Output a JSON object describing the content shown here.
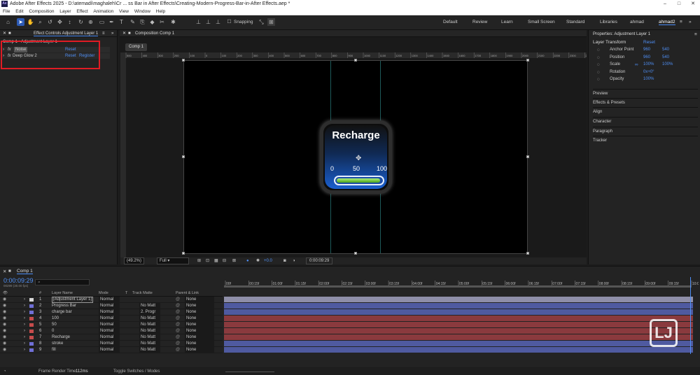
{
  "window": {
    "title": "Adobe After Effects 2025 - D:\\atemadi\\maghaleh\\Cr ... ss Bar in After Effects\\Creating-Modern-Progress-Bar-in-After Effects.aep *",
    "logo": "Ae"
  },
  "menu": [
    "File",
    "Edit",
    "Composition",
    "Layer",
    "Effect",
    "Animation",
    "View",
    "Window",
    "Help"
  ],
  "toolbar": {
    "snapping_label": "Snapping",
    "workspaces": [
      "Default",
      "Review",
      "Learn",
      "Small Screen",
      "Standard",
      "Libraries",
      "ahmad",
      "ahmad2"
    ],
    "active_workspace": "ahmad2"
  },
  "effect_controls": {
    "tab": "Effect Controls Adjustment Layer 1",
    "breadcrumb": "Comp 1 • Adjustment Layer 1",
    "effects": [
      {
        "name": "Noise",
        "reset": "Reset",
        "register": ""
      },
      {
        "name": "Deep Glow 2",
        "reset": "Reset",
        "register": "Register"
      }
    ]
  },
  "composition": {
    "tab": "Composition Comp 1",
    "comp_tab": "Comp 1",
    "zoom": "(49.2%)",
    "resolution": "Full",
    "exposure": "+0.0",
    "timecode": "0:00:09:29",
    "ruler": [
      "500",
      "400",
      "300",
      "200",
      "100",
      "0",
      "100",
      "200",
      "300",
      "400",
      "500",
      "600",
      "700",
      "800",
      "900",
      "1000",
      "1100",
      "1200",
      "1300",
      "1400",
      "1500",
      "1600",
      "1700",
      "1800",
      "1900",
      "2000",
      "2100",
      "2200",
      "2300",
      "2400"
    ]
  },
  "widget": {
    "title": "Recharge",
    "scale": [
      "0",
      "50",
      "100"
    ],
    "progress": 0.97
  },
  "properties": {
    "header": "Properties: Adjustment Layer 1",
    "section": "Layer Transform",
    "reset": "Reset",
    "rows": [
      {
        "label": "Anchor Point",
        "v1": "960",
        "v2": "540"
      },
      {
        "label": "Position",
        "v1": "960",
        "v2": "540"
      },
      {
        "label": "Scale",
        "v1": "100%",
        "v2": "100%"
      },
      {
        "label": "Rotation",
        "v1": "0x+0°",
        "v2": ""
      },
      {
        "label": "Opacity",
        "v1": "100%",
        "v2": ""
      }
    ],
    "panels": [
      "Preview",
      "Effects & Presets",
      "Align",
      "Character",
      "Paragraph",
      "Tracker"
    ]
  },
  "timeline": {
    "tab": "Comp 1",
    "timecode": "0:00:09:29",
    "fps": "00299 (30.00 fps)",
    "headers": {
      "num": "#",
      "layer": "Layer Name",
      "mode": "Mode",
      "t": "T",
      "matte": "Track Matte",
      "parent": "Parent & Link"
    },
    "ticks": [
      "00f",
      "00:15f",
      "01:00f",
      "01:15f",
      "02:00f",
      "02:15f",
      "03:00f",
      "03:15f",
      "04:00f",
      "04:15f",
      "05:00f",
      "05:15f",
      "06:00f",
      "06:15f",
      "07:00f",
      "07:15f",
      "08:00f",
      "08:15f",
      "09:00f",
      "09:15f",
      "10:0"
    ],
    "layers": [
      {
        "n": "1",
        "name": "[Adjustment Layer 1]",
        "mode": "Normal",
        "matte": "",
        "parent": "None",
        "color": "#d8d8d8",
        "bar": "#8e8ea8"
      },
      {
        "n": "2",
        "name": "Progress Bar",
        "mode": "Normal",
        "matte": "No Matt",
        "parent": "None",
        "color": "#6f6fd6",
        "bar": "#4f5aa0"
      },
      {
        "n": "3",
        "name": "charge bar",
        "mode": "Normal",
        "matte": "2. Progr",
        "parent": "None",
        "color": "#6f6fd6",
        "bar": "#4f5aa0"
      },
      {
        "n": "4",
        "name": "100",
        "mode": "Normal",
        "matte": "No Matt",
        "parent": "None",
        "color": "#c64c4c",
        "bar": "#8a3a3e"
      },
      {
        "n": "5",
        "name": "50",
        "mode": "Normal",
        "matte": "No Matt",
        "parent": "None",
        "color": "#c64c4c",
        "bar": "#8a3a3e"
      },
      {
        "n": "6",
        "name": "0",
        "mode": "Normal",
        "matte": "No Matt",
        "parent": "None",
        "color": "#c64c4c",
        "bar": "#8a3a3e"
      },
      {
        "n": "7",
        "name": "Recharge",
        "mode": "Normal",
        "matte": "No Matt",
        "parent": "None",
        "color": "#c64c4c",
        "bar": "#8a3a3e"
      },
      {
        "n": "8",
        "name": "stroke",
        "mode": "Normal",
        "matte": "No Matt",
        "parent": "None",
        "color": "#6f6fd6",
        "bar": "#4f5aa0"
      },
      {
        "n": "9",
        "name": "fill",
        "mode": "Normal",
        "matte": "No Matt",
        "parent": "None",
        "color": "#6f6fd6",
        "bar": "#4f5aa0"
      }
    ]
  },
  "status": {
    "render_label": "Frame Render Time:",
    "render_value": "112ms",
    "toggle": "Toggle Switches / Modes"
  },
  "colors": {
    "accent": "#4f8ff5",
    "highlight": "#e01b24",
    "bar_green": "#6cc93a"
  }
}
